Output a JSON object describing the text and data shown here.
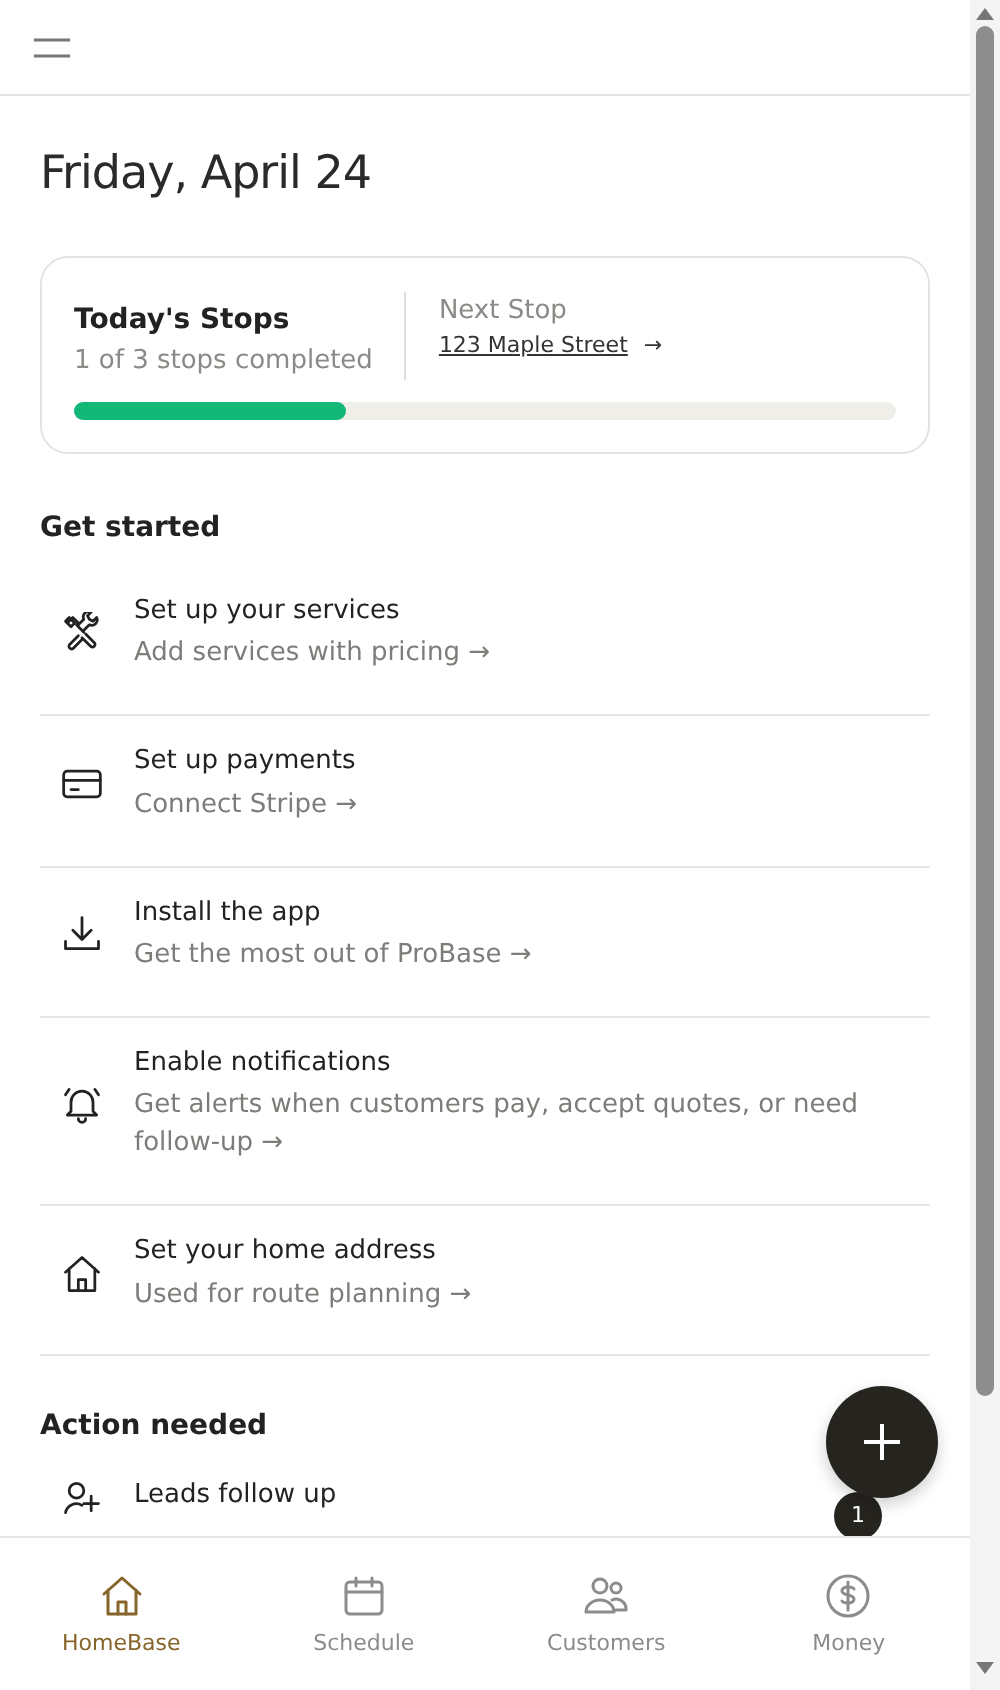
{
  "date_title": "Friday, April 24",
  "stops_card": {
    "title": "Today's Stops",
    "subtitle": "1 of 3 stops completed",
    "level": 0.33,
    "next_label": "Next Stop",
    "next_address": "123 Maple Street",
    "next_arrow": "→"
  },
  "get_started": {
    "title": "Get started",
    "items": [
      {
        "kind": "tools",
        "title": "Set up your services",
        "subtitle": "Add services with pricing →"
      },
      {
        "kind": "card",
        "title": "Set up payments",
        "subtitle": "Connect Stripe →"
      },
      {
        "kind": "download",
        "title": "Install the app",
        "subtitle": "Get the most out of ProBase →"
      },
      {
        "kind": "bell",
        "title": "Enable notifications",
        "subtitle": "Get alerts when customers pay, accept quotes, or need follow-up →"
      },
      {
        "kind": "home",
        "title": "Set your home address",
        "subtitle": "Used for route planning →"
      }
    ]
  },
  "action_needed": {
    "title": "Action needed",
    "items": [
      {
        "kind": "person-add",
        "title": "Leads follow up",
        "count": "1"
      }
    ]
  },
  "bottom_nav": [
    {
      "kind": "home",
      "label": "HomeBase",
      "selected": true
    },
    {
      "kind": "calendar",
      "label": "Schedule",
      "selected": false
    },
    {
      "kind": "people",
      "label": "Customers",
      "selected": false
    },
    {
      "kind": "dollar",
      "label": "Money",
      "selected": false
    }
  ]
}
